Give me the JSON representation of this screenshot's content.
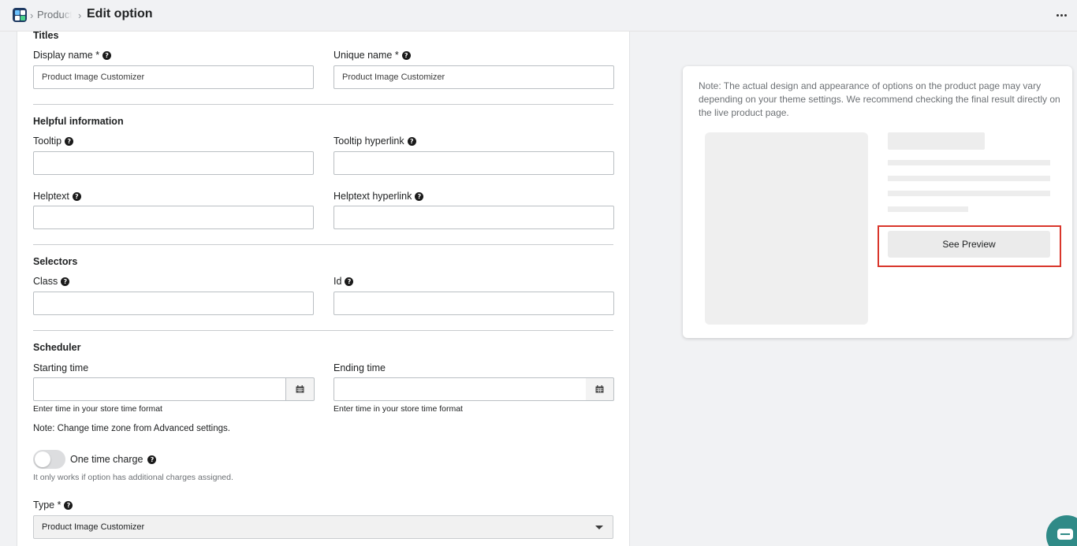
{
  "breadcrumb": {
    "parent": "Product",
    "current": "Edit option"
  },
  "sections": {
    "titles": "Titles",
    "helpful": "Helpful information",
    "selectors": "Selectors",
    "scheduler": "Scheduler"
  },
  "fields": {
    "display_name_label": "Display name *",
    "display_name_value": "Product Image Customizer",
    "unique_name_label": "Unique name *",
    "unique_name_value": "Product Image Customizer",
    "tooltip_label": "Tooltip",
    "tooltip_value": "",
    "tooltip_link_label": "Tooltip hyperlink",
    "tooltip_link_value": "",
    "helptext_label": "Helptext",
    "helptext_value": "",
    "helptext_link_label": "Helptext hyperlink",
    "helptext_link_value": "",
    "class_label": "Class",
    "class_value": "",
    "id_label": "Id",
    "id_value": "",
    "starting_time_label": "Starting time",
    "starting_time_value": "",
    "ending_time_label": "Ending time",
    "ending_time_value": "",
    "time_hint": "Enter time in your store time format"
  },
  "timezone_note": "Note: Change time zone from Advanced settings.",
  "one_time_charge": {
    "label": "One time charge",
    "enabled": false,
    "help": "It only works if option has additional charges assigned."
  },
  "type_field": {
    "label": "Type *",
    "selected": "Product Image Customizer"
  },
  "preview": {
    "note": "Note: The actual design and appearance of options on the product page may vary depending on your theme settings. We recommend checking the final result directly on the live product page.",
    "button_label": "See Preview"
  },
  "colors": {
    "highlight": "#d9362b",
    "chat_bubble": "#2f8a87"
  },
  "icons": {
    "help": "?"
  }
}
